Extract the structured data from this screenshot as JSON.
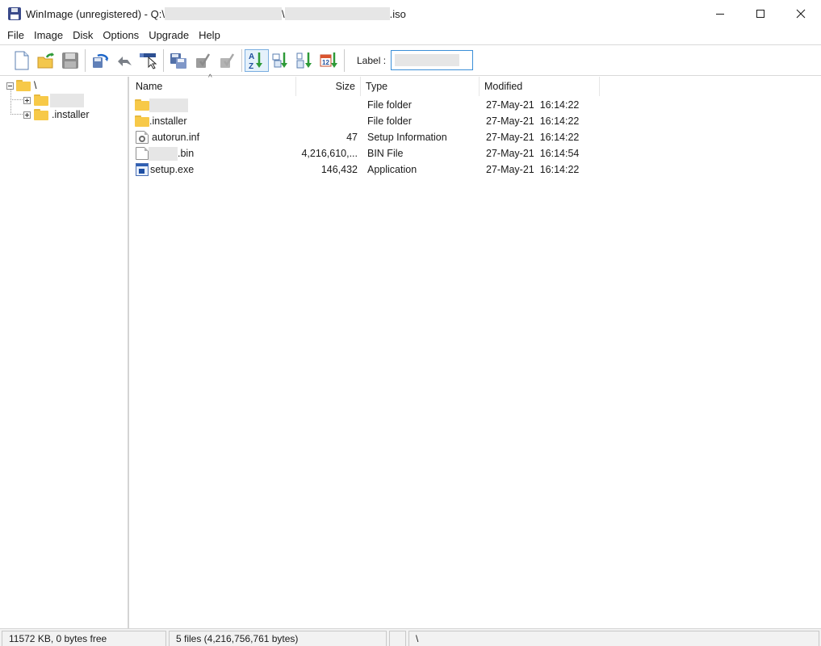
{
  "window": {
    "title_prefix": "WinImage (unregistered) - Q:\\",
    "title_sep": "\\",
    "title_suffix": ".iso",
    "minimize_glyph": "—",
    "close_glyph": "✕"
  },
  "menu": [
    "File",
    "Image",
    "Disk",
    "Options",
    "Upgrade",
    "Help"
  ],
  "toolbar": {
    "label_caption": "Label :",
    "label_value": "",
    "buttons": [
      "new-icon",
      "open-icon",
      "save-icon",
      "inject-icon",
      "extract-icon",
      "select-icon",
      "copy-disk-icon",
      "check-icon",
      "check-disabled-icon",
      "sort-name-icon",
      "sort-ext-icon",
      "sort-size-icon",
      "sort-date-icon"
    ]
  },
  "tree": {
    "root": "\\",
    "items": [
      "",
      ".installer"
    ]
  },
  "list": {
    "columns": {
      "name": "Name",
      "size": "Size",
      "type": "Type",
      "modified": "Modified"
    },
    "sort_caret": "^",
    "rows": [
      {
        "name": "",
        "size": "",
        "type": "File folder",
        "modified": "27-May-21  16:14:22",
        "icon": "folder-icon"
      },
      {
        "name": ".installer",
        "size": "",
        "type": "File folder",
        "modified": "27-May-21  16:14:22",
        "icon": "folder-icon"
      },
      {
        "name": "autorun.inf",
        "size": "47",
        "type": "Setup Information",
        "modified": "27-May-21  16:14:22",
        "icon": "settings-file-icon"
      },
      {
        "name": ".bin",
        "size": "4,216,610,...",
        "type": "BIN File",
        "modified": "27-May-21  16:14:54",
        "icon": "file-icon"
      },
      {
        "name": "setup.exe",
        "size": "146,432",
        "type": "Application",
        "modified": "27-May-21  16:14:22",
        "icon": "application-icon"
      }
    ]
  },
  "status": {
    "disk": "11572 KB, 0 bytes free",
    "files": "5 files (4,216,756,761 bytes)",
    "blank": "",
    "path": "\\"
  }
}
